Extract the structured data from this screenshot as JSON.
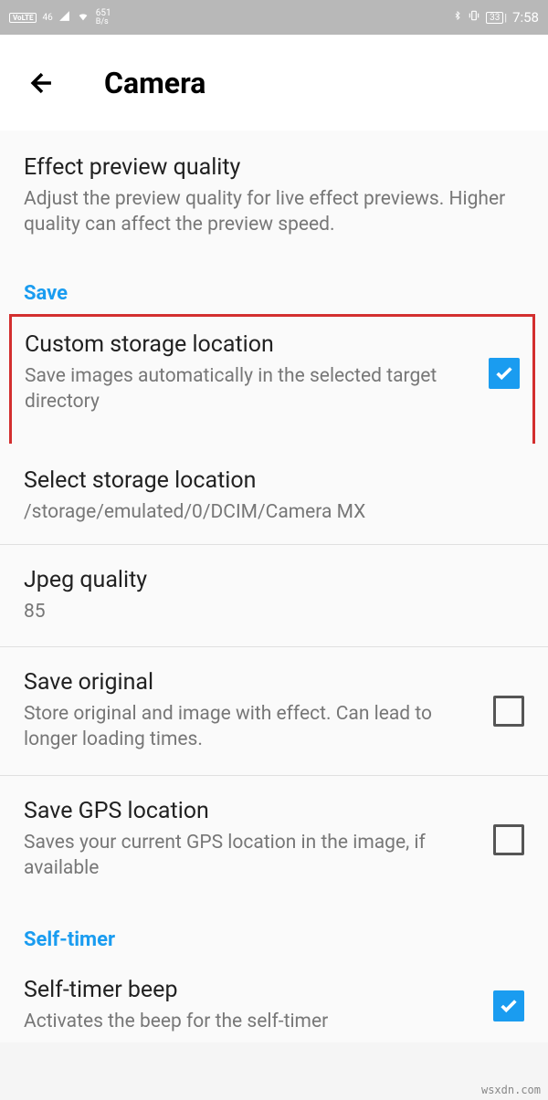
{
  "statusBar": {
    "volte": "VoLTE",
    "signalStrength": "46",
    "dataRate": "651",
    "dataUnit": "B/s",
    "battery": "33",
    "time": "7:58"
  },
  "appBar": {
    "title": "Camera"
  },
  "settings": {
    "effectPreview": {
      "title": "Effect preview quality",
      "desc": "Adjust the preview quality for live effect previews. Higher quality can affect the preview speed."
    },
    "saveHeader": "Save",
    "customStorage": {
      "title": "Custom storage location",
      "desc": "Save images automatically in the selected target directory"
    },
    "selectStorage": {
      "title": "Select storage location",
      "desc": "/storage/emulated/0/DCIM/Camera MX"
    },
    "jpegQuality": {
      "title": "Jpeg quality",
      "value": "85"
    },
    "saveOriginal": {
      "title": "Save original",
      "desc": "Store original and image with effect. Can lead to longer loading times."
    },
    "saveGps": {
      "title": "Save GPS location",
      "desc": "Saves your current GPS location in the image, if available"
    },
    "selfTimerHeader": "Self-timer",
    "selfTimerBeep": {
      "title": "Self-timer beep",
      "desc": "Activates the beep for the self-timer"
    }
  },
  "watermark": "wsxdn.com"
}
